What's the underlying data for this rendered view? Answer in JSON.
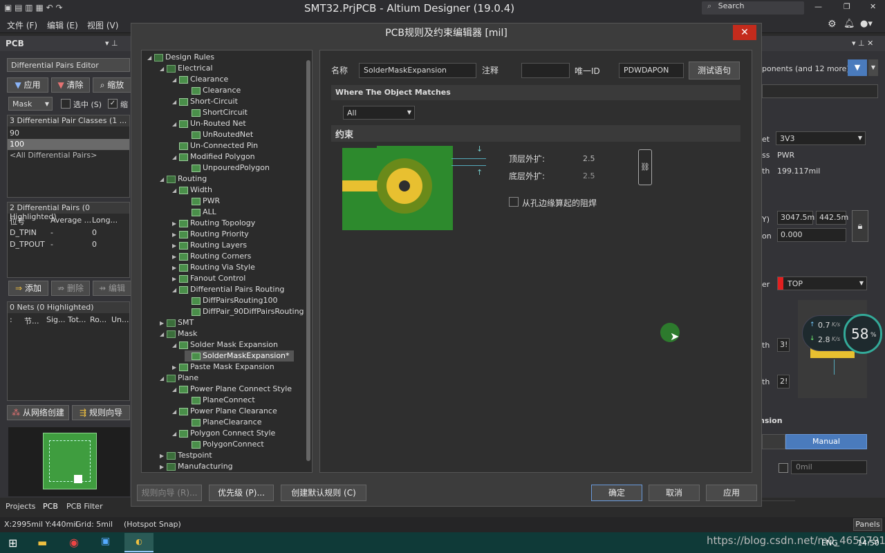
{
  "window": {
    "title": "SMT32.PrjPCB - Altium Designer (19.0.4)",
    "search_placeholder": "Search"
  },
  "menubar": {
    "items": [
      "文件 (F)",
      "编辑 (E)",
      "视图 (V)"
    ]
  },
  "left_panel": {
    "title": "PCB",
    "mode_select": "Differential Pairs Editor",
    "apply_label": "应用",
    "clear_label": "清除",
    "zoom_label": "缩放",
    "mask_select": "Mask",
    "select_label": "选中 (S)",
    "zoom2_label": "缩",
    "classes_header": "3 Differential Pair Classes (1 ...",
    "classes": [
      "90",
      "100",
      "<All Differential Pairs>"
    ],
    "pairs_header": "2 Differential Pairs (0 Highlighted)",
    "pairs_columns": [
      "位号",
      "Average ...",
      "Long..."
    ],
    "pairs": [
      {
        "name": "D_TPIN",
        "avg": "-",
        "long": "0"
      },
      {
        "name": "D_TPOUT",
        "avg": "-",
        "long": "0"
      }
    ],
    "add_label": "添加",
    "delete_label": "删除",
    "edit_label": "编辑",
    "nets_header": "0 Nets (0 Highlighted)",
    "nets_columns": [
      ":",
      "节...",
      "Sig...",
      "Tot...",
      "Ro...",
      "Un..."
    ],
    "from_net_label": "从网络创建",
    "wizard_label": "规则向导"
  },
  "bottom_tabs": {
    "items": [
      "Projects",
      "PCB",
      "PCB Filter"
    ]
  },
  "status_bar": {
    "coords": "X:2995mil Y:440mil",
    "grid": "Grid: 5mil",
    "snap": "(Hotspot Snap)",
    "panels": "Panels"
  },
  "dialog": {
    "title": "PCB规则及约束编辑器 [mil]",
    "tree": [
      {
        "label": "Design Rules",
        "level": 0,
        "tri": "◢",
        "icon": "grp"
      },
      {
        "label": "Electrical",
        "level": 1,
        "tri": "◢",
        "icon": "grp"
      },
      {
        "label": "Clearance",
        "level": 2,
        "tri": "◢",
        "icon": "rule"
      },
      {
        "label": "Clearance",
        "level": 3,
        "tri": "",
        "icon": "rule"
      },
      {
        "label": "Short-Circuit",
        "level": 2,
        "tri": "◢",
        "icon": "rule"
      },
      {
        "label": "ShortCircuit",
        "level": 3,
        "tri": "",
        "icon": "rule"
      },
      {
        "label": "Un-Routed Net",
        "level": 2,
        "tri": "◢",
        "icon": "rule"
      },
      {
        "label": "UnRoutedNet",
        "level": 3,
        "tri": "",
        "icon": "rule"
      },
      {
        "label": "Un-Connected Pin",
        "level": 2,
        "tri": "",
        "icon": "rule"
      },
      {
        "label": "Modified Polygon",
        "level": 2,
        "tri": "◢",
        "icon": "rule"
      },
      {
        "label": "UnpouredPolygon",
        "level": 3,
        "tri": "",
        "icon": "rule"
      },
      {
        "label": "Routing",
        "level": 1,
        "tri": "◢",
        "icon": "grp"
      },
      {
        "label": "Width",
        "level": 2,
        "tri": "◢",
        "icon": "rule"
      },
      {
        "label": "PWR",
        "level": 3,
        "tri": "",
        "icon": "rule"
      },
      {
        "label": "ALL",
        "level": 3,
        "tri": "",
        "icon": "rule"
      },
      {
        "label": "Routing Topology",
        "level": 2,
        "tri": "▶",
        "icon": "rule"
      },
      {
        "label": "Routing Priority",
        "level": 2,
        "tri": "▶",
        "icon": "rule"
      },
      {
        "label": "Routing Layers",
        "level": 2,
        "tri": "▶",
        "icon": "rule"
      },
      {
        "label": "Routing Corners",
        "level": 2,
        "tri": "▶",
        "icon": "rule"
      },
      {
        "label": "Routing Via Style",
        "level": 2,
        "tri": "▶",
        "icon": "rule"
      },
      {
        "label": "Fanout Control",
        "level": 2,
        "tri": "▶",
        "icon": "rule"
      },
      {
        "label": "Differential Pairs Routing",
        "level": 2,
        "tri": "◢",
        "icon": "rule"
      },
      {
        "label": "DiffPairsRouting100",
        "level": 3,
        "tri": "",
        "icon": "rule"
      },
      {
        "label": "DiffPair_90DiffPairsRouting",
        "level": 3,
        "tri": "",
        "icon": "rule"
      },
      {
        "label": "SMT",
        "level": 1,
        "tri": "▶",
        "icon": "grp"
      },
      {
        "label": "Mask",
        "level": 1,
        "tri": "◢",
        "icon": "grp"
      },
      {
        "label": "Solder Mask Expansion",
        "level": 2,
        "tri": "◢",
        "icon": "rule"
      },
      {
        "label": "SolderMaskExpansion*",
        "level": 3,
        "tri": "",
        "icon": "rule",
        "selected": true
      },
      {
        "label": "Paste Mask Expansion",
        "level": 2,
        "tri": "▶",
        "icon": "rule"
      },
      {
        "label": "Plane",
        "level": 1,
        "tri": "◢",
        "icon": "grp"
      },
      {
        "label": "Power Plane Connect Style",
        "level": 2,
        "tri": "◢",
        "icon": "rule"
      },
      {
        "label": "PlaneConnect",
        "level": 3,
        "tri": "",
        "icon": "rule"
      },
      {
        "label": "Power Plane Clearance",
        "level": 2,
        "tri": "◢",
        "icon": "rule"
      },
      {
        "label": "PlaneClearance",
        "level": 3,
        "tri": "",
        "icon": "rule"
      },
      {
        "label": "Polygon Connect Style",
        "level": 2,
        "tri": "◢",
        "icon": "rule"
      },
      {
        "label": "PolygonConnect",
        "level": 3,
        "tri": "",
        "icon": "rule"
      },
      {
        "label": "Testpoint",
        "level": 1,
        "tri": "▶",
        "icon": "grp"
      },
      {
        "label": "Manufacturing",
        "level": 1,
        "tri": "▶",
        "icon": "grp"
      }
    ],
    "name_label": "名称",
    "name_value": "SolderMaskExpansion",
    "comment_label": "注释",
    "comment_value": "",
    "uid_label": "唯一ID",
    "uid_value": "PDWDAPON",
    "test_button": "测试语句",
    "where_header": "Where The Object Matches",
    "where_select": "All",
    "constraint_header": "约束",
    "top_label": "顶层外扩:",
    "top_value": "2.5",
    "bottom_label": "底层外扩:",
    "bottom_value": "2.5",
    "from_hole_label": "从孔边缘算起的阻焊",
    "wizard_button": "规则向导 (R)...",
    "priority_button": "优先级 (P)...",
    "default_button": "创建默认规则 (C)",
    "ok_button": "确定",
    "cancel_button": "取消",
    "apply_button": "应用"
  },
  "right_panel": {
    "filter_text": "ponents (and 12 more)",
    "net_label": "et",
    "net_value": "3V3",
    "class_label": "ss",
    "class_value": "PWR",
    "length_label": "th",
    "length_value": "199.117mil",
    "y_label": "Y)",
    "x_value": "3047.5m",
    "y_value": "442.5m",
    "rotation_label": "on",
    "rotation_value": "0.000",
    "layer_label": "er",
    "layer_value": "TOP",
    "th1_label": "th",
    "th1_value": "3!",
    "th2_label": "th",
    "th2_value": "2!",
    "expansion_label": "nsion",
    "manual_label": "Manual",
    "mil_placeholder": "0mil",
    "net_up": "0.7",
    "net_down": "2.8",
    "net_unit": "K/s",
    "cpu": "58",
    "cpu_unit": "%"
  },
  "taskbar": {
    "watermark": "https://blog.csdn.net/m0_46507918",
    "lang": "ENG",
    "time": "14:50"
  }
}
